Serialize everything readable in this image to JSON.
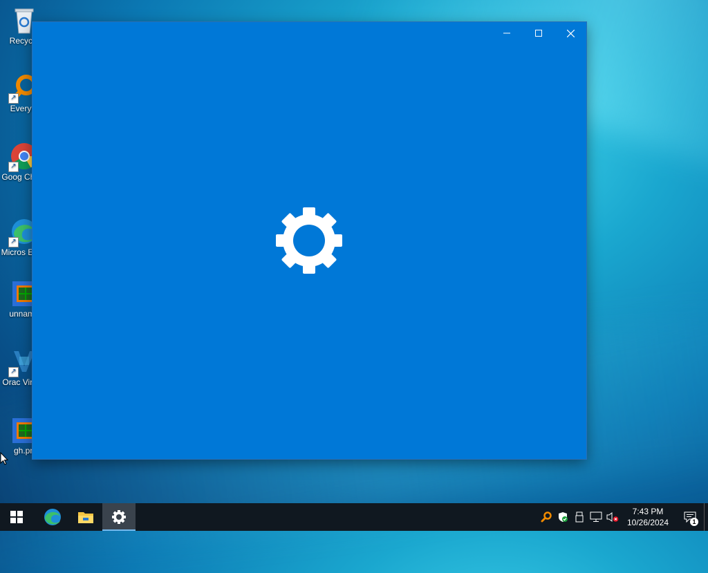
{
  "desktop": {
    "icons": [
      {
        "label": "Recycle",
        "icon": "recycle-bin-icon"
      },
      {
        "label": "Everyth",
        "icon": "everything-search-icon"
      },
      {
        "label": "Goog Chron",
        "icon": "chrome-icon"
      },
      {
        "label": "Micros Edge",
        "icon": "edge-icon"
      },
      {
        "label": "unname",
        "icon": "image-file-icon"
      },
      {
        "label": "Orac Virtual",
        "icon": "virtualbox-icon"
      },
      {
        "label": "gh.pn",
        "icon": "image-file-icon"
      }
    ]
  },
  "window": {
    "app": "Settings",
    "splash_icon": "gear-icon",
    "background_color": "#0078d7",
    "controls": {
      "minimize": "minimize-icon",
      "maximize": "maximize-icon",
      "close": "close-icon"
    }
  },
  "taskbar": {
    "start": "windows-logo-icon",
    "pinned": [
      "edge-icon",
      "file-explorer-icon",
      "settings-gear-icon"
    ],
    "active_app": "Settings",
    "tray": [
      "everything-search-icon",
      "windows-security-icon",
      "usb-eject-icon",
      "network-icon",
      "volume-muted-icon"
    ],
    "time": "7:43 PM",
    "date": "10/26/2024",
    "notifications": "1"
  }
}
